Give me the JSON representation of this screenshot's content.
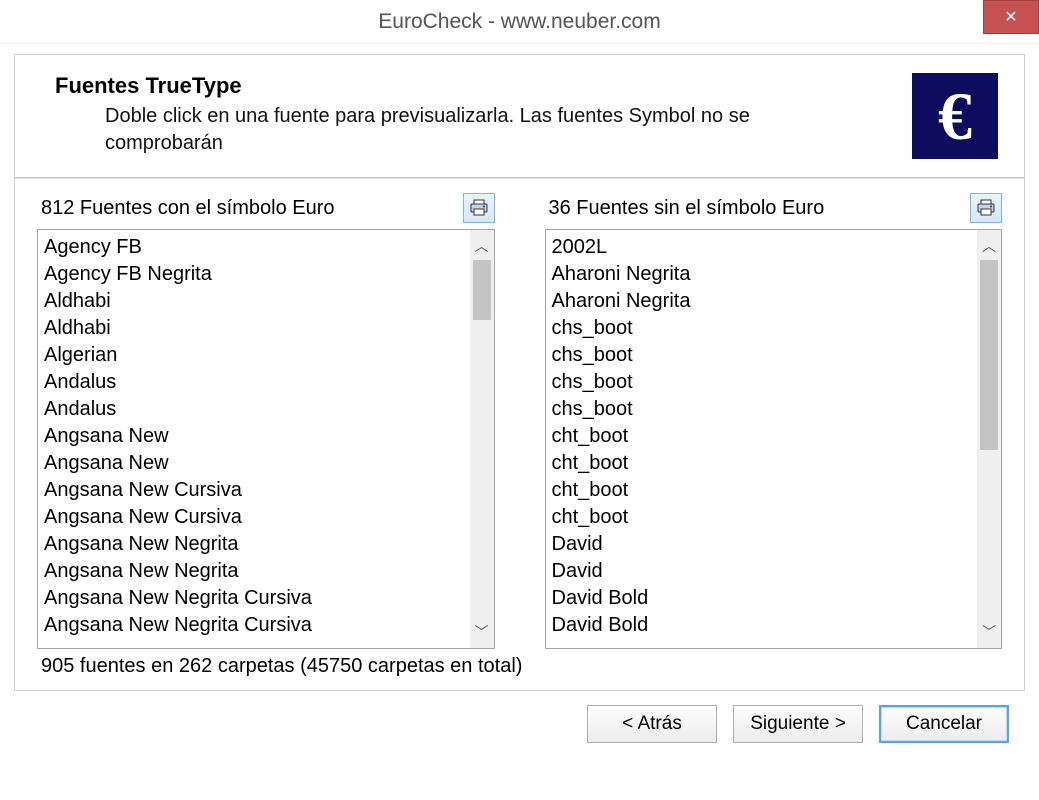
{
  "window": {
    "title": "EuroCheck - www.neuber.com",
    "close_glyph": "✕"
  },
  "header": {
    "title": "Fuentes TrueType",
    "subtitle": "Doble click en una fuente para previsualizarla. Las fuentes Symbol no se comprobarán",
    "euro_glyph": "€"
  },
  "left": {
    "label": "812 Fuentes con el símbolo Euro",
    "items": [
      "Agency FB",
      "Agency FB Negrita",
      "Aldhabi",
      "Aldhabi",
      "Algerian",
      "Andalus",
      "Andalus",
      "Angsana New",
      "Angsana New",
      "Angsana New Cursiva",
      "Angsana New Cursiva",
      "Angsana New Negrita",
      "Angsana New Negrita",
      "Angsana New Negrita Cursiva",
      "Angsana New Negrita Cursiva"
    ]
  },
  "right": {
    "label": "36 Fuentes sin el símbolo Euro",
    "items": [
      "2002L",
      "Aharoni Negrita",
      "Aharoni Negrita",
      "chs_boot",
      "chs_boot",
      "chs_boot",
      "chs_boot",
      "cht_boot",
      "cht_boot",
      "cht_boot",
      "cht_boot",
      "David",
      "David",
      "David Bold",
      "David Bold"
    ]
  },
  "status": "905 fuentes en 262 carpetas (45750 carpetas en total)",
  "buttons": {
    "back": "< Atrás",
    "next": "Siguiente >",
    "cancel": "Cancelar"
  },
  "scroll": {
    "up": "︿",
    "down": "﹀"
  }
}
